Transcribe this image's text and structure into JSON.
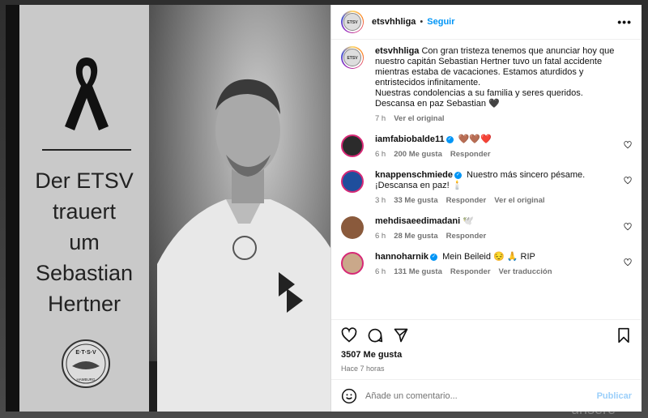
{
  "backdrop": {
    "text": "unsere"
  },
  "image": {
    "banner_lines": "Der ETSV\ntrauert\num\nSebastian\nHertner",
    "logo_text": "E·T·S·V",
    "logo_subtext": "HAMBURG"
  },
  "header": {
    "username": "etsvhhliga",
    "dot": "•",
    "follow_label": "Seguir",
    "more_label": "•••"
  },
  "caption": {
    "username": "etsvhhliga",
    "text_line1": "Con gran tristeza tenemos que anunciar hoy que nuestro capitán Sebastian Hertner tuvo un fatal accidente mientras estaba de vacaciones. Estamos aturdidos y entristecidos infinitamente.",
    "text_line2": "Nuestras condolencias a su familia y seres queridos. Descansa en paz Sebastian 🖤",
    "time": "7 h",
    "see_original": "Ver el original"
  },
  "comments": [
    {
      "username": "iamfabiobalde11",
      "verified": true,
      "text": "🤎🤎❤️",
      "time": "6 h",
      "likes": "200 Me gusta",
      "reply": "Responder",
      "extra": "",
      "avatar_color": "#2b2b2b"
    },
    {
      "username": "knappenschmiede",
      "verified": true,
      "text": "Nuestro más sincero pésame. ¡Descansa en paz! 🕯️",
      "time": "3 h",
      "likes": "33 Me gusta",
      "reply": "Responder",
      "extra": "Ver el original",
      "avatar_color": "#1f4e9c"
    },
    {
      "username": "mehdisaeedimadani",
      "verified": false,
      "text": "🕊️",
      "time": "6 h",
      "likes": "28 Me gusta",
      "reply": "Responder",
      "extra": "",
      "avatar_color": "#8a5a3c"
    },
    {
      "username": "hannoharnik",
      "verified": true,
      "text": "Mein Beileid 😔 🙏 RIP",
      "time": "6 h",
      "likes": "131 Me gusta",
      "reply": "Responder",
      "extra": "Ver traducción",
      "avatar_color": "#caa88a"
    }
  ],
  "post": {
    "likes": "3507 Me gusta",
    "time_ago": "Hace 7 horas"
  },
  "add_comment": {
    "placeholder": "Añade un comentario...",
    "publish_label": "Publicar"
  }
}
